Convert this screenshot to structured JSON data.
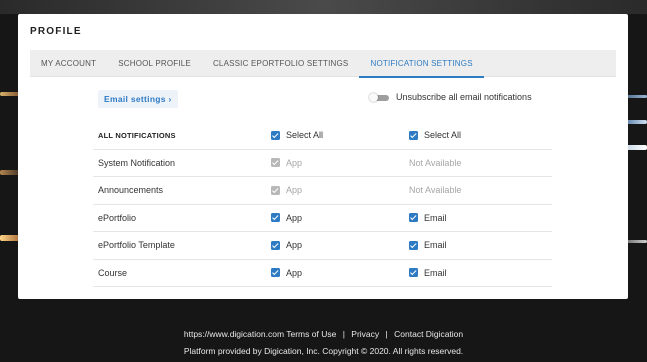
{
  "page": {
    "title": "PROFILE"
  },
  "tabs": [
    {
      "label": "MY ACCOUNT",
      "active": false
    },
    {
      "label": "SCHOOL PROFILE",
      "active": false
    },
    {
      "label": "CLASSIC EPORTFOLIO SETTINGS",
      "active": false
    },
    {
      "label": "NOTIFICATION SETTINGS",
      "active": true
    }
  ],
  "email_settings": {
    "label": "Email settings ›"
  },
  "unsubscribe": {
    "label": "Unsubscribe all email notifications",
    "on": false
  },
  "table": {
    "header": {
      "label": "ALL NOTIFICATIONS",
      "app": "Select All",
      "email": "Select All"
    },
    "rows": [
      {
        "label": "System Notification",
        "app": "App",
        "email": "Not Available"
      },
      {
        "label": "Announcements",
        "app": "App",
        "email": "Not Available"
      },
      {
        "label": "ePortfolio",
        "app": "App",
        "email": "Email"
      },
      {
        "label": "ePortfolio Template",
        "app": "App",
        "email": "Email"
      },
      {
        "label": "Course",
        "app": "App",
        "email": "Email"
      }
    ]
  },
  "footer": {
    "url": "https://www.digication.com",
    "terms": "Terms of Use",
    "privacy": "Privacy",
    "contact": "Contact Digication",
    "separator": "|",
    "copyright": "Platform provided by Digication, Inc. Copyright © 2020. All rights reserved."
  },
  "colors": {
    "accent": "#2e7bc4",
    "disabled": "#b8b8b8",
    "background": "#161616"
  }
}
